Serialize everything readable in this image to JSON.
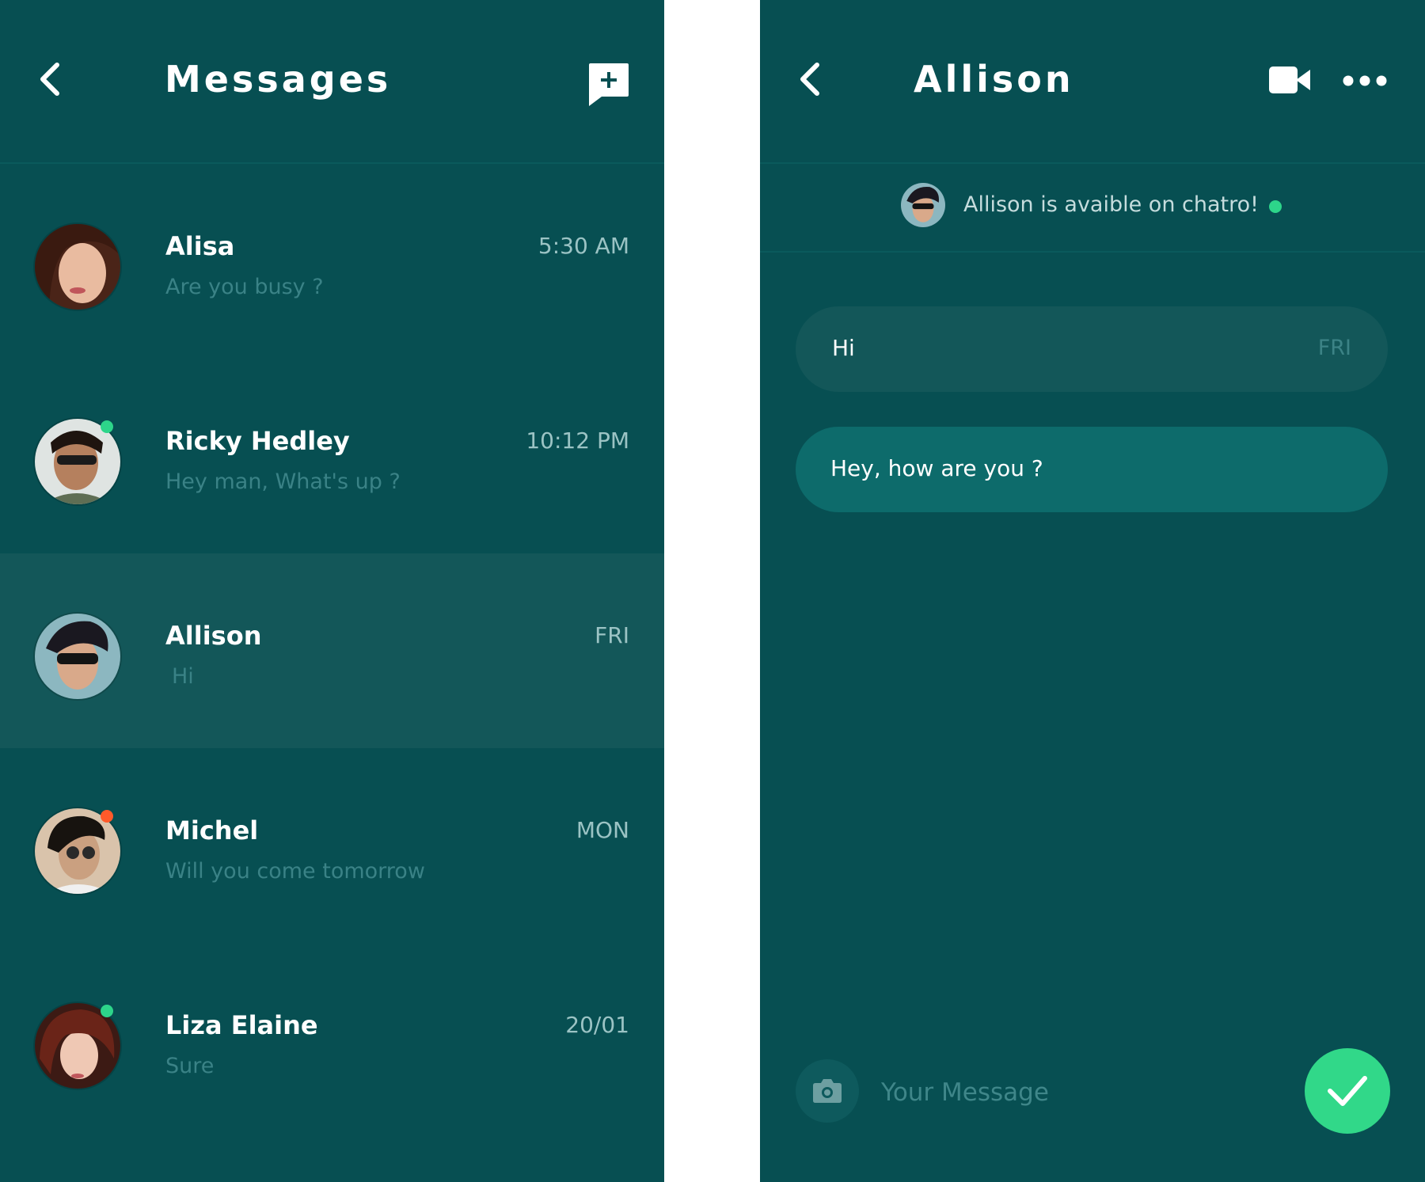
{
  "colors": {
    "background": "#074f52",
    "selected_row": "#135759",
    "bubble_incoming": "#135759",
    "bubble_outgoing": "#0d6b6b",
    "online": "#2dd58a",
    "busy": "#ff5a2a",
    "send_button": "#31d889"
  },
  "messages_screen": {
    "title": "Messages",
    "back_icon": "chevron-left-icon",
    "new_message_icon": "new-message-icon",
    "conversations": [
      {
        "name": "Alisa",
        "preview": "Are you busy ?",
        "time": "5:30 AM",
        "status": "none",
        "selected": false
      },
      {
        "name": "Ricky Hedley",
        "preview": "Hey man, What's up ?",
        "time": "10:12 PM",
        "status": "online",
        "selected": false
      },
      {
        "name": "Allison",
        "preview": "Hi",
        "time": "FRI",
        "status": "none",
        "selected": true
      },
      {
        "name": "Michel",
        "preview": "Will you come tomorrow",
        "time": "MON",
        "status": "busy",
        "selected": false
      },
      {
        "name": "Liza Elaine",
        "preview": "Sure",
        "time": "20/01",
        "status": "online",
        "selected": false
      }
    ]
  },
  "chat_screen": {
    "title": "Allison",
    "back_icon": "chevron-left-icon",
    "video_icon": "video-camera-icon",
    "more_icon": "more-dots-icon",
    "availability_text": "Allison is avaible on chatro!",
    "messages": [
      {
        "text": "Hi",
        "time": "FRI",
        "type": "incoming"
      },
      {
        "text": "Hey, how are you ?",
        "time": "",
        "type": "outgoing"
      }
    ],
    "input": {
      "placeholder": "Your Message",
      "value": ""
    },
    "camera_icon": "camera-icon",
    "send_icon": "checkmark-icon"
  }
}
